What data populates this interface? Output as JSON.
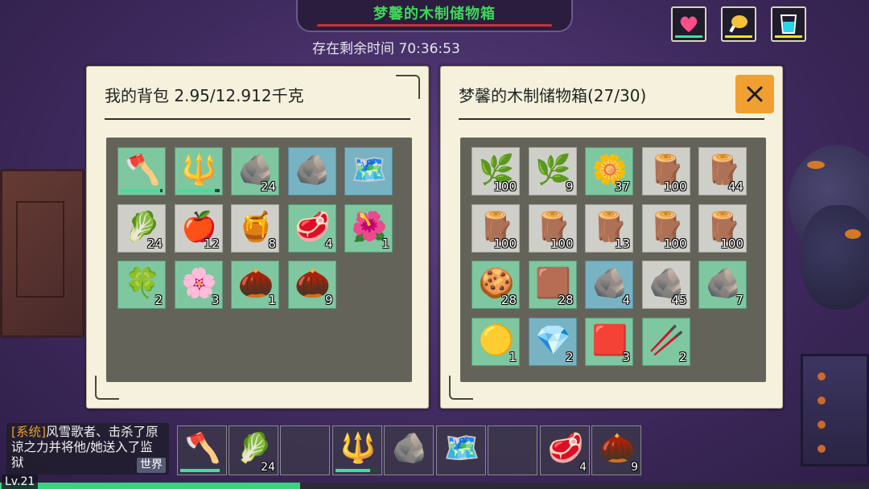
{
  "banner": {
    "title": "梦馨的木制储物箱",
    "timer": "存在剩余时间 70:36:53"
  },
  "status": [
    {
      "name": "health",
      "icon": "heart-icon",
      "color": "#ff4f8b",
      "meter_color": "#3ee0a0"
    },
    {
      "name": "food",
      "icon": "meat-icon",
      "color": "#f2c23a",
      "meter_color": "#f2e22a"
    },
    {
      "name": "water",
      "icon": "cup-icon",
      "color": "#26d6ea",
      "meter_color": "#f2e22a"
    }
  ],
  "backpack": {
    "title": "我的背包  2.95/12.912千克",
    "slots": [
      {
        "icon": "stone-axe-icon",
        "glyph": "🪓",
        "qty": "",
        "bg": "green",
        "durability": 0.95
      },
      {
        "icon": "crystal-staff-icon",
        "glyph": "🔱",
        "qty": "",
        "bg": "green",
        "durability": 0.9
      },
      {
        "icon": "obsidian-ore-icon",
        "glyph": "🪨",
        "qty": "24",
        "bg": "green"
      },
      {
        "icon": "flint-stone-icon",
        "glyph": "🪨",
        "qty": "",
        "bg": "blue"
      },
      {
        "icon": "treasure-map-icon",
        "glyph": "🗺️",
        "qty": "",
        "bg": "blue"
      },
      {
        "icon": "spinach-icon",
        "glyph": "🥬",
        "qty": "24",
        "bg": "gray"
      },
      {
        "icon": "apple-icon",
        "glyph": "🍎",
        "qty": "12",
        "bg": "gray"
      },
      {
        "icon": "honeycomb-icon",
        "glyph": "🍯",
        "qty": "8",
        "bg": "gray"
      },
      {
        "icon": "raw-meat-icon",
        "glyph": "🥩",
        "qty": "4",
        "bg": "green"
      },
      {
        "icon": "red-flower-icon",
        "glyph": "🌺",
        "qty": "1",
        "bg": "green"
      },
      {
        "icon": "green-herb-icon",
        "glyph": "🍀",
        "qty": "2",
        "bg": "green"
      },
      {
        "icon": "purple-flower-icon",
        "glyph": "🌸",
        "qty": "3",
        "bg": "green"
      },
      {
        "icon": "seed-horn-icon",
        "glyph": "🌰",
        "qty": "1",
        "bg": "green"
      },
      {
        "icon": "cotton-seed-horn-icon",
        "glyph": "🌰",
        "qty": "9",
        "bg": "green"
      }
    ]
  },
  "chest": {
    "title": "梦馨的木制储物箱(27/30)",
    "slots": [
      {
        "icon": "fiber-icon",
        "glyph": "🌿",
        "qty": "100",
        "bg": "gray"
      },
      {
        "icon": "fiber-icon",
        "glyph": "🌿",
        "qty": "9",
        "bg": "gray"
      },
      {
        "icon": "cotton-icon",
        "glyph": "🌼",
        "qty": "37",
        "bg": "green"
      },
      {
        "icon": "wood-bundle-icon",
        "glyph": "🪵",
        "qty": "100",
        "bg": "gray"
      },
      {
        "icon": "wood-bundle-icon",
        "glyph": "🪵",
        "qty": "44",
        "bg": "gray"
      },
      {
        "icon": "wood-bundle-icon",
        "glyph": "🪵",
        "qty": "100",
        "bg": "gray"
      },
      {
        "icon": "log-icon",
        "glyph": "🪵",
        "qty": "100",
        "bg": "gray"
      },
      {
        "icon": "log-icon",
        "glyph": "🪵",
        "qty": "13",
        "bg": "gray"
      },
      {
        "icon": "log-icon",
        "glyph": "🪵",
        "qty": "100",
        "bg": "gray"
      },
      {
        "icon": "log-icon",
        "glyph": "🪵",
        "qty": "100",
        "bg": "gray"
      },
      {
        "icon": "wood-slice-icon",
        "glyph": "🍪",
        "qty": "28",
        "bg": "green"
      },
      {
        "icon": "soil-icon",
        "glyph": "🟫",
        "qty": "28",
        "bg": "green"
      },
      {
        "icon": "copper-ore-icon",
        "glyph": "🪨",
        "qty": "4",
        "bg": "blue"
      },
      {
        "icon": "stone-icon",
        "glyph": "🪨",
        "qty": "45",
        "bg": "gray"
      },
      {
        "icon": "coal-icon",
        "glyph": "🪨",
        "qty": "7",
        "bg": "green"
      },
      {
        "icon": "gold-nugget-icon",
        "glyph": "🟡",
        "qty": "1",
        "bg": "green"
      },
      {
        "icon": "blue-gem-icon",
        "glyph": "💎",
        "qty": "2",
        "bg": "blue"
      },
      {
        "icon": "leather-hide-icon",
        "glyph": "🟥",
        "qty": "3",
        "bg": "green"
      },
      {
        "icon": "branch-icon",
        "glyph": "🥢",
        "qty": "2",
        "bg": "green"
      }
    ]
  },
  "chat": {
    "tag": "[系统]",
    "message": "风雪歌者、击杀了原谅之力并将他/她送入了监狱",
    "channel": "世界"
  },
  "hotbar": [
    {
      "icon": "stone-axe-icon",
      "glyph": "🪓",
      "qty": "",
      "durability": 0.9
    },
    {
      "icon": "spinach-icon",
      "glyph": "🥬",
      "qty": "24"
    },
    {
      "icon": "empty-slot",
      "glyph": "",
      "qty": ""
    },
    {
      "icon": "crystal-staff-icon",
      "glyph": "🔱",
      "qty": "",
      "durability": 0.8
    },
    {
      "icon": "flint-stone-icon",
      "glyph": "🪨",
      "qty": ""
    },
    {
      "icon": "treasure-map-icon",
      "glyph": "🗺️",
      "qty": ""
    },
    {
      "icon": "empty-slot",
      "glyph": "",
      "qty": ""
    },
    {
      "icon": "raw-meat-icon",
      "glyph": "🥩",
      "qty": "4"
    },
    {
      "icon": "cotton-seed-horn-icon",
      "glyph": "🌰",
      "qty": "9"
    }
  ],
  "player": {
    "level": "Lv.21",
    "xp_fraction": 0.345
  }
}
